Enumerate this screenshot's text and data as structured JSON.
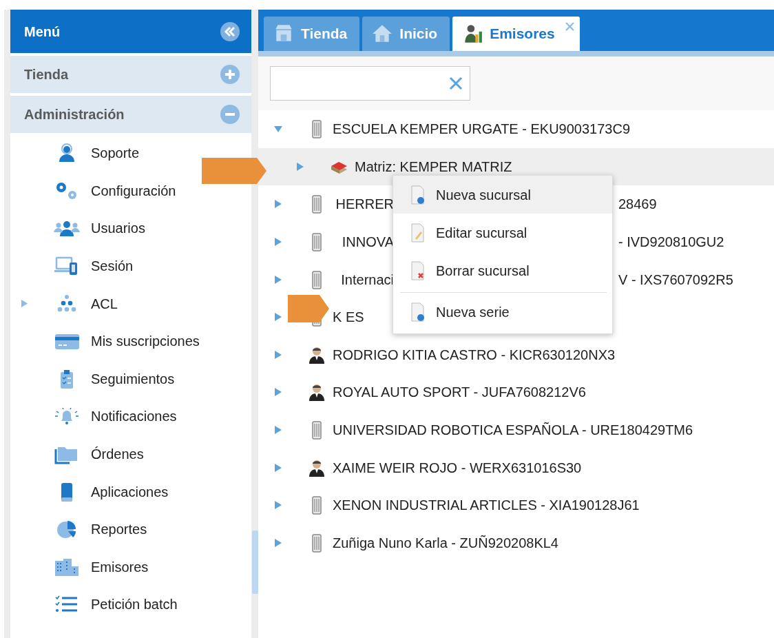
{
  "sidebar": {
    "title": "Menú",
    "sections": [
      {
        "label": "Tienda",
        "expanded": false
      },
      {
        "label": "Administración",
        "expanded": true
      }
    ],
    "items": [
      {
        "label": "Soporte",
        "expandable": false
      },
      {
        "label": "Configuración",
        "expandable": false
      },
      {
        "label": "Usuarios",
        "expandable": false
      },
      {
        "label": "Sesión",
        "expandable": false
      },
      {
        "label": "ACL",
        "expandable": true
      },
      {
        "label": "Mis suscripciones",
        "expandable": false
      },
      {
        "label": "Seguimientos",
        "expandable": false
      },
      {
        "label": "Notificaciones",
        "expandable": false
      },
      {
        "label": "Órdenes",
        "expandable": false
      },
      {
        "label": "Aplicaciones",
        "expandable": false
      },
      {
        "label": "Reportes",
        "expandable": false
      },
      {
        "label": "Emisores",
        "expandable": false
      },
      {
        "label": "Petición batch",
        "expandable": false
      }
    ]
  },
  "tabs": [
    {
      "label": "Tienda",
      "selected": false,
      "closable": false
    },
    {
      "label": "Inicio",
      "selected": false,
      "closable": false
    },
    {
      "label": "Emisores",
      "selected": true,
      "closable": true
    }
  ],
  "tree": [
    {
      "kind": "company",
      "expanded": true,
      "selected": false,
      "label_parts": [
        "ESCUELA KEMPER URGATE - EKU9003173C9"
      ],
      "children": [
        {
          "kind": "branch",
          "expanded": false,
          "selected": true,
          "label_parts": [
            "Matriz: KEMPER MATRIZ"
          ]
        }
      ]
    },
    {
      "kind": "company",
      "expanded": false,
      "selected": false,
      "label_parts": [
        "HERRER",
        "28469"
      ]
    },
    {
      "kind": "company",
      "expanded": false,
      "selected": false,
      "label_parts": [
        "INNOVA",
        "- IVD920810GU2"
      ]
    },
    {
      "kind": "company",
      "expanded": false,
      "selected": false,
      "label_parts": [
        "Internaci",
        "V - IXS7607092R5"
      ]
    },
    {
      "kind": "company",
      "expanded": false,
      "selected": false,
      "label_parts": [
        "K ES"
      ]
    },
    {
      "kind": "person",
      "expanded": false,
      "selected": false,
      "label_parts": [
        "RODRIGO KITIA CASTRO - KICR630120NX3"
      ]
    },
    {
      "kind": "person",
      "expanded": false,
      "selected": false,
      "label_parts": [
        "ROYAL AUTO SPORT - JUFA7608212V6"
      ]
    },
    {
      "kind": "company",
      "expanded": false,
      "selected": false,
      "label_parts": [
        "UNIVERSIDAD ROBOTICA ESPAÑOLA - URE180429TM6"
      ]
    },
    {
      "kind": "person",
      "expanded": false,
      "selected": false,
      "label_parts": [
        "XAIME WEIR ROJO - WERX631016S30"
      ]
    },
    {
      "kind": "company",
      "expanded": false,
      "selected": false,
      "label_parts": [
        "XENON INDUSTRIAL ARTICLES - XIA190128J61"
      ]
    },
    {
      "kind": "company",
      "expanded": false,
      "selected": false,
      "label_parts": [
        "Zuñiga Nuno Karla - ZUÑ920208KL4"
      ]
    }
  ],
  "context_menu": [
    {
      "kind": "new",
      "label": "Nueva sucursal",
      "highlighted": true
    },
    {
      "kind": "edit",
      "label": "Editar sucursal",
      "highlighted": false
    },
    {
      "kind": "delete",
      "label": "Borrar sucursal",
      "highlighted": false
    },
    {
      "kind": "separator"
    },
    {
      "kind": "new",
      "label": "Nueva serie",
      "highlighted": false
    }
  ]
}
